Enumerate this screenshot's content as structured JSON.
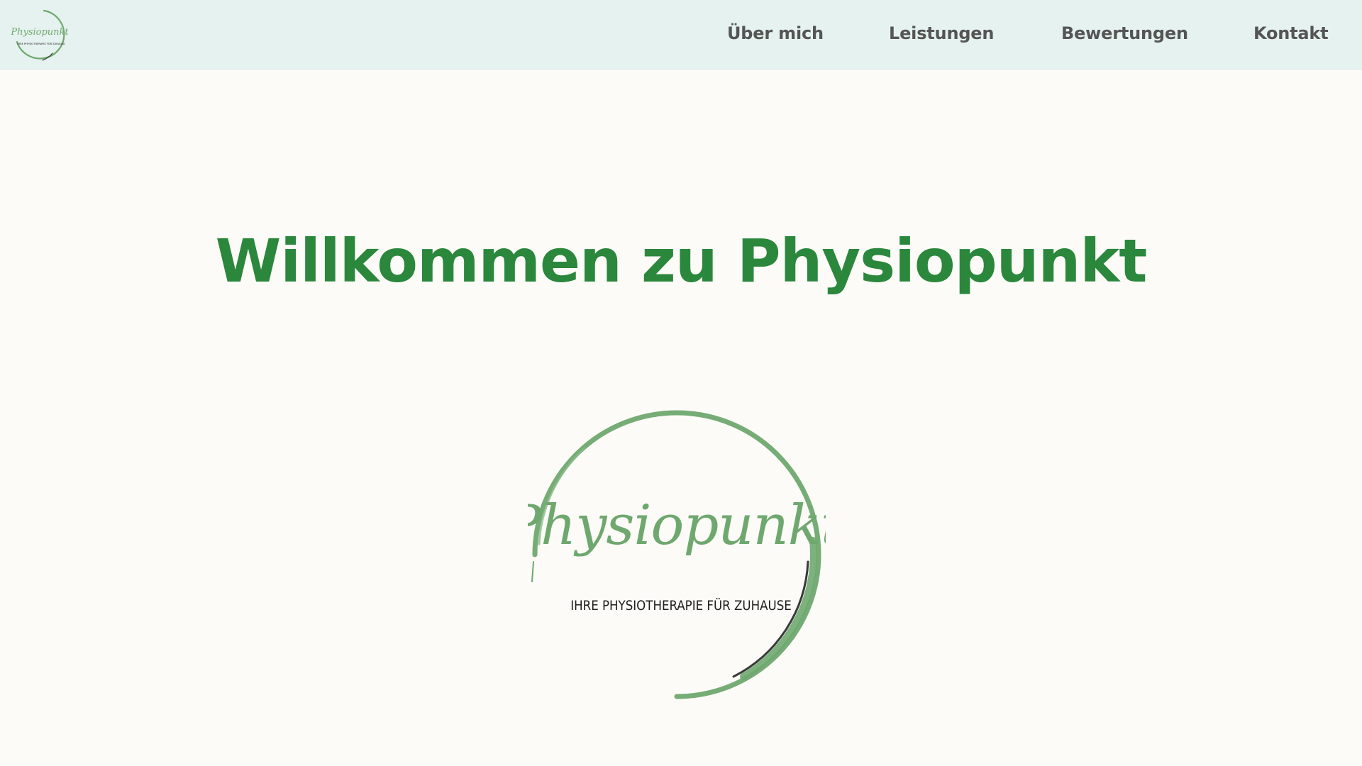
{
  "header": {
    "logo": {
      "wordmark": "Physiopunkt",
      "tagline": "IHRE PHYSIOTHERAPIE FÜR ZUHAUSE",
      "color": "#6fa86f"
    },
    "nav_items": [
      {
        "label": "Über mich"
      },
      {
        "label": "Leistungen"
      },
      {
        "label": "Bewertungen"
      },
      {
        "label": "Kontakt"
      }
    ],
    "background": "#e6f2ef",
    "text_color": "#555555"
  },
  "main": {
    "title": "Willkommen zu Physiopunkt",
    "title_color": "#2a873c",
    "background": "#fdfbf7",
    "logo": {
      "wordmark": "Physiopunkt",
      "tagline": "IHRE PHYSIOTHERAPIE FÜR ZUHAUSE",
      "circle_color": "#6fa86f",
      "accent_color": "#3a3a3a"
    }
  }
}
